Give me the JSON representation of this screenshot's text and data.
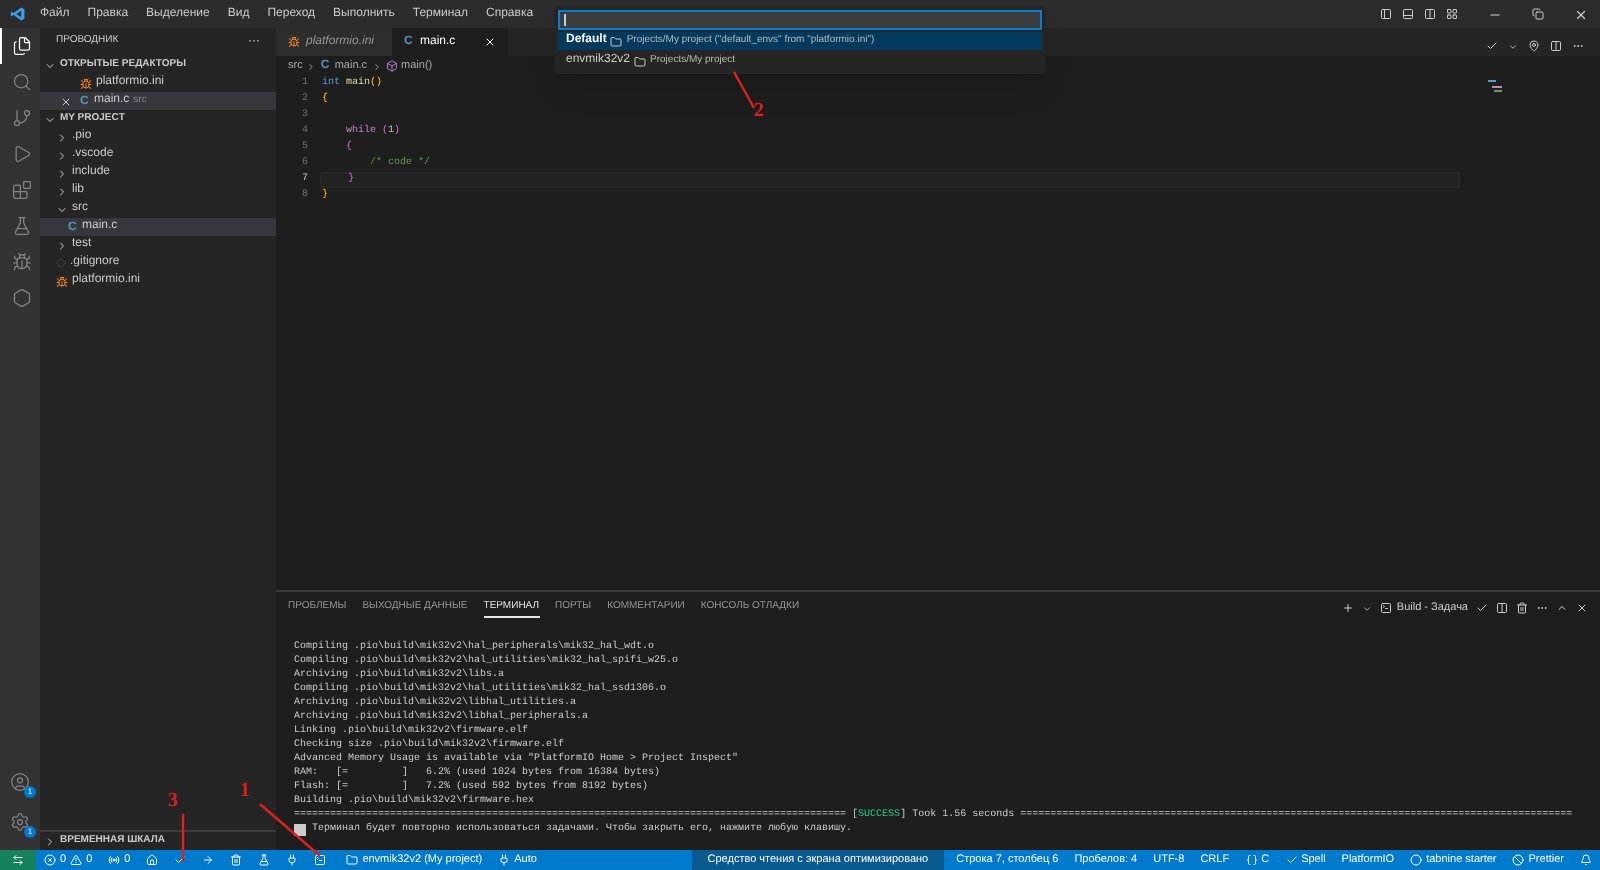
{
  "menu": [
    "Файл",
    "Правка",
    "Выделение",
    "Вид",
    "Переход",
    "Выполнить",
    "Терминал",
    "Справка"
  ],
  "activity_bar": {
    "top": [
      {
        "kind": "explorer",
        "selected": true
      },
      {
        "kind": "search",
        "selected": false
      },
      {
        "kind": "scm",
        "selected": false
      },
      {
        "kind": "run",
        "selected": false
      },
      {
        "kind": "extensions",
        "selected": false
      },
      {
        "kind": "testing",
        "selected": false
      },
      {
        "kind": "platformio",
        "selected": false
      },
      {
        "kind": "remote",
        "selected": false
      }
    ],
    "bottom": [
      {
        "kind": "accounts",
        "badge": "1"
      },
      {
        "kind": "manage",
        "badge": "1"
      }
    ]
  },
  "explorer": {
    "title": "ПРОВОДНИК",
    "more": "···",
    "sections": [
      {
        "title": "ОТКРЫТЫЕ РЕДАКТОРЫ",
        "expanded": true,
        "items": [
          {
            "label": "platformio.ini",
            "kind": "platformio",
            "selected": false
          },
          {
            "label": "main.c",
            "kind": "c",
            "icon": "C",
            "description": "src",
            "selected": true
          }
        ]
      },
      {
        "title": "MY PROJECT",
        "expanded": true,
        "items": [
          {
            "label": ".pio",
            "kind": "folder",
            "expanded": false,
            "selected": false
          },
          {
            "label": ".vscode",
            "kind": "folder",
            "expanded": false,
            "selected": false
          },
          {
            "label": "include",
            "kind": "folder",
            "expanded": false,
            "selected": false
          },
          {
            "label": "lib",
            "kind": "folder",
            "expanded": false,
            "selected": false
          },
          {
            "label": "src",
            "kind": "folder",
            "expanded": true,
            "selected": false,
            "children": [
              {
                "label": "main.c",
                "kind": "c",
                "icon": "C",
                "selected": true
              }
            ]
          },
          {
            "label": "test",
            "kind": "folder",
            "expanded": false,
            "selected": false
          },
          {
            "label": ".gitignore",
            "kind": "git",
            "selected": false
          },
          {
            "label": "platformio.ini",
            "kind": "platformio",
            "selected": false
          }
        ]
      }
    ],
    "timeline": {
      "title": "ВРЕМЕННАЯ ШКАЛА",
      "expanded": false
    }
  },
  "editor": {
    "tabs": [
      {
        "label": "platformio.ini",
        "kind": "platformio",
        "selected": false,
        "preview": true
      },
      {
        "label": "main.c",
        "kind": "c",
        "icon": "C",
        "selected": true,
        "preview": false
      }
    ],
    "breadcrumb": [
      {
        "kind": "folder",
        "text": "src"
      },
      {
        "kind": "c",
        "icon": "C",
        "text": "main.c"
      },
      {
        "kind": "function",
        "text": "main()"
      }
    ],
    "lines": [
      {
        "number": "1",
        "current": false,
        "tokens": [
          {
            "kind": "keyword",
            "text": "int "
          },
          {
            "kind": "function",
            "text": "main"
          },
          {
            "kind": "bracket1",
            "text": "()"
          }
        ]
      },
      {
        "number": "2",
        "current": false,
        "tokens": [
          {
            "kind": "bracket1",
            "text": "{"
          }
        ]
      },
      {
        "number": "3",
        "current": false
      },
      {
        "number": "4",
        "current": false,
        "tokens": [
          {
            "kind": "control",
            "text": "    while "
          },
          {
            "kind": "bracket2",
            "text": "("
          },
          {
            "kind": "number",
            "text": "1"
          },
          {
            "kind": "bracket2",
            "text": ")"
          }
        ]
      },
      {
        "number": "5",
        "current": false,
        "tokens": [
          {
            "kind": "bracket2",
            "text": "    {"
          }
        ]
      },
      {
        "number": "6",
        "current": false,
        "tokens": [
          {
            "kind": "comment",
            "text": "        /* code */"
          }
        ]
      },
      {
        "number": "7",
        "current": true,
        "tokens": [
          {
            "kind": "bracket2",
            "text": "    }"
          }
        ]
      },
      {
        "number": "8",
        "current": false,
        "tokens": [
          {
            "kind": "bracket1",
            "text": "}"
          }
        ]
      }
    ]
  },
  "quick_pick": {
    "items": [
      {
        "label": "Default",
        "detail": "Projects/My project (\"default_envs\" from \"platformio.ini\")",
        "selected": true
      },
      {
        "label": "envmik32v2",
        "detail": "Projects/My project",
        "selected": false
      }
    ]
  },
  "panel": {
    "tabs": [
      {
        "label": "ПРОБЛЕМЫ",
        "selected": false
      },
      {
        "label": "ВЫХОДНЫЕ ДАННЫЕ",
        "selected": false
      },
      {
        "label": "ТЕРМИНАЛ",
        "selected": true
      },
      {
        "label": "ПОРТЫ",
        "selected": false
      },
      {
        "label": "КОММЕНТАРИИ",
        "selected": false
      },
      {
        "label": "КОНСОЛЬ ОТЛАДКИ",
        "selected": false
      }
    ],
    "task": "Build - Задача",
    "terminal": [
      "Compiling .pio\\build\\mik32v2\\hal_peripherals\\mik32_hal_wdt.o",
      "Compiling .pio\\build\\mik32v2\\hal_utilities\\mik32_hal_spifi_w25.o",
      "Archiving .pio\\build\\mik32v2\\libs.a",
      "Compiling .pio\\build\\mik32v2\\hal_utilities\\mik32_hal_ssd1306.o",
      "Archiving .pio\\build\\mik32v2\\libhal_utilities.a",
      "Archiving .pio\\build\\mik32v2\\libhal_peripherals.a",
      "Linking .pio\\build\\mik32v2\\firmware.elf",
      "Checking size .pio\\build\\mik32v2\\firmware.elf",
      "Advanced Memory Usage is available via \"PlatformIO Home > Project Inspect\"",
      "RAM:   [=         ]   6.2% (used 1024 bytes from 16384 bytes)",
      "Flash: [=         ]   7.2% (used 592 bytes from 8192 bytes)",
      "Building .pio\\build\\mik32v2\\firmware.hex"
    ],
    "result": {
      "before": "============================================================================================ [",
      "status": "SUCCESS",
      "after": "] Took 1.56 seconds ============================================================================================"
    },
    "message": "Терминал будет повторно использоваться задачами. Чтобы закрыть его, нажмите любую клавишу."
  },
  "status_bar": {
    "left": [
      {
        "kind": "remote"
      },
      {
        "kind": "problems",
        "errors": "0",
        "warnings": "0"
      },
      {
        "kind": "ports",
        "count": "0"
      },
      {
        "kind": "home"
      },
      {
        "kind": "build"
      },
      {
        "kind": "upload"
      },
      {
        "kind": "clean"
      },
      {
        "kind": "test"
      },
      {
        "kind": "serial"
      },
      {
        "kind": "terminal"
      },
      {
        "kind": "env",
        "text": "envmik32v2 (My project)"
      },
      {
        "kind": "port",
        "text": "Auto"
      }
    ],
    "right": [
      {
        "kind": "notice",
        "text": "Средство чтения с экрана оптимизировано"
      },
      {
        "kind": "text",
        "text": "Строка 7, столбец 6"
      },
      {
        "kind": "text",
        "text": "Пробелов: 4"
      },
      {
        "kind": "text",
        "text": "UTF-8"
      },
      {
        "kind": "text",
        "text": "CRLF"
      },
      {
        "kind": "language",
        "text": "C"
      },
      {
        "kind": "spell",
        "text": "Spell"
      },
      {
        "kind": "text",
        "text": "PlatformIO"
      },
      {
        "kind": "tabnine",
        "text": "tabnine starter"
      },
      {
        "kind": "prettier",
        "text": "Prettier"
      },
      {
        "kind": "bell"
      }
    ]
  },
  "annotations": [
    {
      "text": "1"
    },
    {
      "text": "2"
    },
    {
      "text": "3"
    }
  ]
}
